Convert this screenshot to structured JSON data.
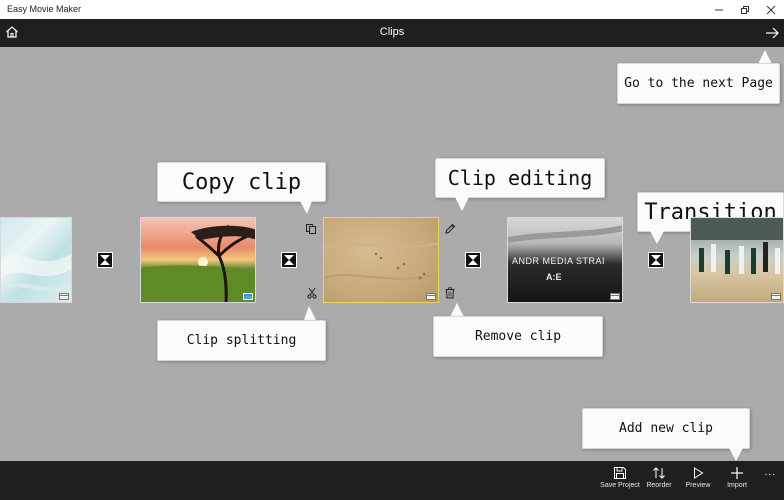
{
  "window": {
    "title": "Easy Movie Maker"
  },
  "header": {
    "title": "Clips"
  },
  "clips": [
    {
      "name": "beach"
    },
    {
      "name": "sunset-tree"
    },
    {
      "name": "sand",
      "selected": true
    },
    {
      "name": "media-strait"
    },
    {
      "name": "basketball"
    }
  ],
  "thumb_text": {
    "media_strait": "ANDR MEDIA STRAI",
    "media_strait_logo": "A:E"
  },
  "callouts": {
    "next_page": "Go to the next Page",
    "copy_clip": "Copy clip",
    "clip_editing": "Clip editing",
    "transition": "Transition",
    "clip_splitting": "Clip splitting",
    "remove_clip": "Remove clip",
    "add_new_clip": "Add new clip"
  },
  "appbar": {
    "save": "Save Project",
    "reorder": "Reorder",
    "preview": "Preview",
    "import": "Import",
    "more": "..."
  },
  "colors": {
    "background": "#ababab",
    "bar": "#1f1f1f",
    "selected_border": "#e8d36a"
  }
}
